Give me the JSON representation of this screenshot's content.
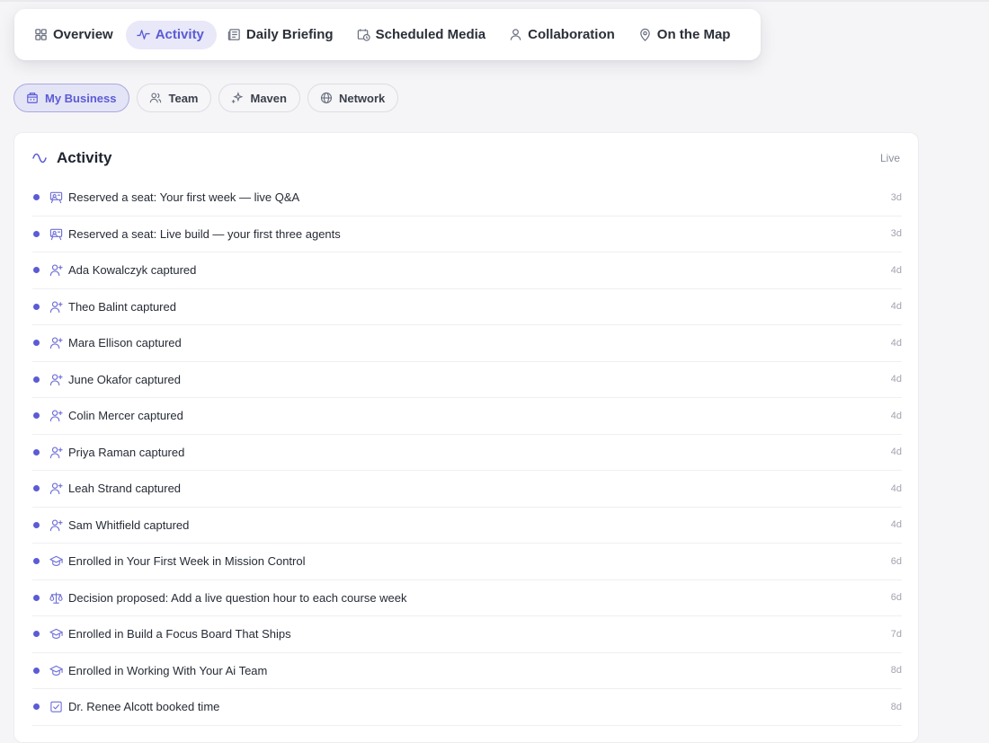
{
  "nav": {
    "tabs": [
      {
        "label": "Overview",
        "icon": "grid-icon"
      },
      {
        "label": "Activity",
        "icon": "activity-icon",
        "active": true
      },
      {
        "label": "Daily Briefing",
        "icon": "newspaper-icon"
      },
      {
        "label": "Scheduled Media",
        "icon": "calendar-clock-icon"
      },
      {
        "label": "Collaboration",
        "icon": "user-icon"
      },
      {
        "label": "On the Map",
        "icon": "map-pin-icon"
      }
    ]
  },
  "filters": [
    {
      "label": "My Business",
      "icon": "building-icon",
      "active": true
    },
    {
      "label": "Team",
      "icon": "users-icon"
    },
    {
      "label": "Maven",
      "icon": "sparkles-icon"
    },
    {
      "label": "Network",
      "icon": "globe-icon"
    }
  ],
  "activity": {
    "title": "Activity",
    "status": "Live",
    "items": [
      {
        "icon": "presentation-icon",
        "text": "Reserved a seat: Your first week — live Q&A",
        "time": "3d"
      },
      {
        "icon": "presentation-icon",
        "text": "Reserved a seat: Live build — your first three agents",
        "time": "3d"
      },
      {
        "icon": "user-plus-icon",
        "text": "Ada Kowalczyk captured",
        "time": "4d"
      },
      {
        "icon": "user-plus-icon",
        "text": "Theo Balint captured",
        "time": "4d"
      },
      {
        "icon": "user-plus-icon",
        "text": "Mara Ellison captured",
        "time": "4d"
      },
      {
        "icon": "user-plus-icon",
        "text": "June Okafor captured",
        "time": "4d"
      },
      {
        "icon": "user-plus-icon",
        "text": "Colin Mercer captured",
        "time": "4d"
      },
      {
        "icon": "user-plus-icon",
        "text": "Priya Raman captured",
        "time": "4d"
      },
      {
        "icon": "user-plus-icon",
        "text": "Leah Strand captured",
        "time": "4d"
      },
      {
        "icon": "user-plus-icon",
        "text": "Sam Whitfield captured",
        "time": "4d"
      },
      {
        "icon": "graduation-cap-icon",
        "text": "Enrolled in Your First Week in Mission Control",
        "time": "6d"
      },
      {
        "icon": "scale-icon",
        "text": "Decision proposed: Add a live question hour to each course week",
        "time": "6d"
      },
      {
        "icon": "graduation-cap-icon",
        "text": "Enrolled in Build a Focus Board That Ships",
        "time": "7d"
      },
      {
        "icon": "graduation-cap-icon",
        "text": "Enrolled in Working With Your Ai Team",
        "time": "8d"
      },
      {
        "icon": "calendar-check-icon",
        "text": "Dr. Renee Alcott booked time",
        "time": "8d"
      }
    ]
  }
}
